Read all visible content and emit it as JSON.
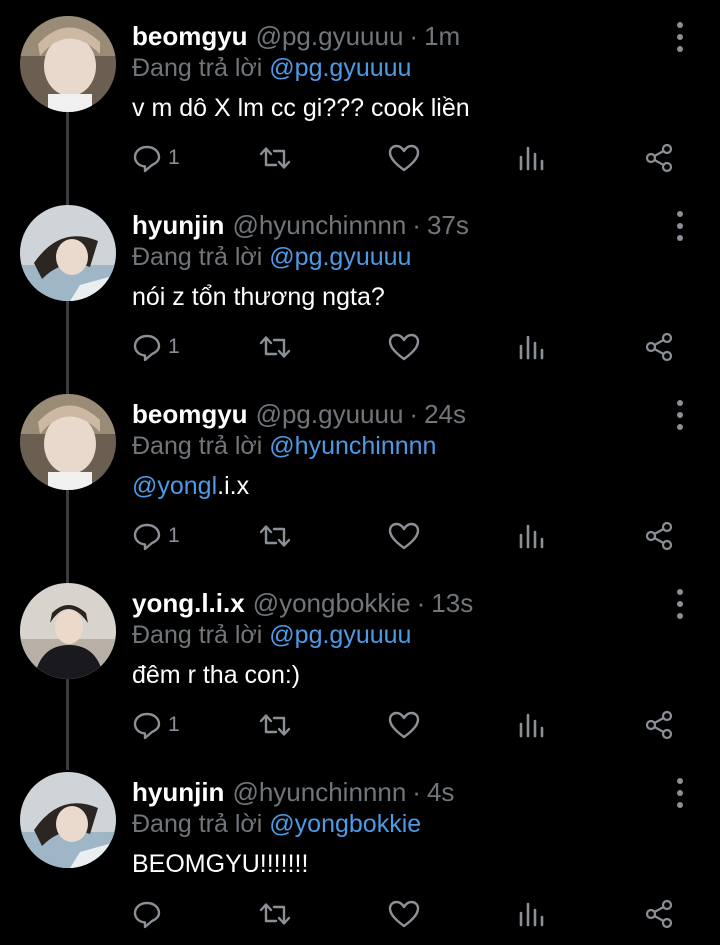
{
  "colors": {
    "background": "#000000",
    "text": "#ffffff",
    "muted": "#71767b",
    "mention": "#4d9ae6",
    "icon": "#8b9096"
  },
  "reply_prefix": "Đang trả lời",
  "tweets": [
    {
      "name": "beomgyu",
      "handle": "@pg.gyuuuu",
      "time": "1m",
      "reply_to": "@pg.gyuuuu",
      "text_mention": "",
      "text": "v m dô X lm cc gi??? cook liền",
      "reply_count": "1",
      "avatar": "avatar-beomgyu"
    },
    {
      "name": "hyunjin",
      "handle": "@hyunchinnnn",
      "time": "37s",
      "reply_to": "@pg.gyuuuu",
      "text_mention": "",
      "text": "nói z tổn thương ngta?",
      "reply_count": "1",
      "avatar": "avatar-hyunjin"
    },
    {
      "name": "beomgyu",
      "handle": "@pg.gyuuuu",
      "time": "24s",
      "reply_to": "@hyunchinnnn",
      "text_mention": "@yongl",
      "text": ".i.x",
      "reply_count": "1",
      "avatar": "avatar-beomgyu"
    },
    {
      "name": "yong.l.i.x",
      "handle": "@yongbokkie",
      "time": "13s",
      "reply_to": "@pg.gyuuuu",
      "text_mention": "",
      "text": "đêm r tha con:)",
      "reply_count": "1",
      "avatar": "avatar-yonglix"
    },
    {
      "name": "hyunjin",
      "handle": "@hyunchinnnn",
      "time": "4s",
      "reply_to": "@yongbokkie",
      "text_mention": "",
      "text": "BEOMGYU!!!!!!!",
      "reply_count": "",
      "avatar": "avatar-hyunjin"
    }
  ]
}
